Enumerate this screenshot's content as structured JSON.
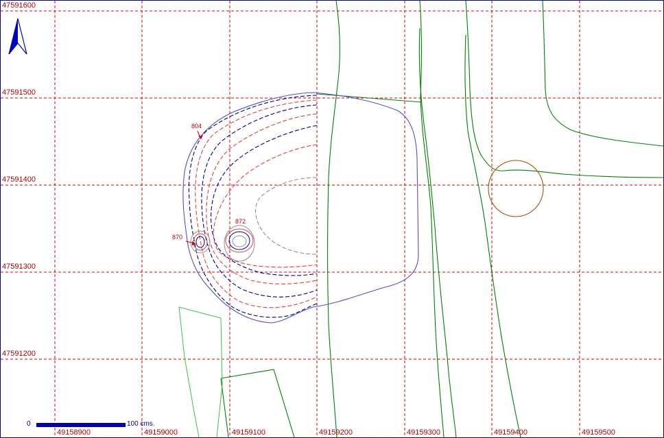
{
  "grid": {
    "line_color": "#d40000",
    "easting_labels": [
      "49158900",
      "49159000",
      "49159100",
      "49159200",
      "49159300",
      "49159400",
      "49159500"
    ],
    "northing_labels": [
      "47591600",
      "47591500",
      "47591400",
      "47591300",
      "47591200"
    ]
  },
  "spot_heights": [
    {
      "id": "804",
      "label": "804"
    },
    {
      "id": "872",
      "label": "872"
    },
    {
      "id": "870",
      "label": "870"
    }
  ],
  "scale_bar": {
    "start_label": "0",
    "end_label": "100",
    "unit_label": "cms.",
    "fill_fraction": 1.0
  },
  "colors": {
    "north_arrow": "#0000c0",
    "boundary": "#5050d0",
    "contour_dark": "#000080",
    "contour_red": "#e04040",
    "contour_grey": "#909090",
    "road_green": "#008000",
    "light_green": "#40c040",
    "circle_brown": "#a05010",
    "frame": "#0000a0"
  },
  "icons": {
    "north_arrow": "north-arrow-icon"
  }
}
